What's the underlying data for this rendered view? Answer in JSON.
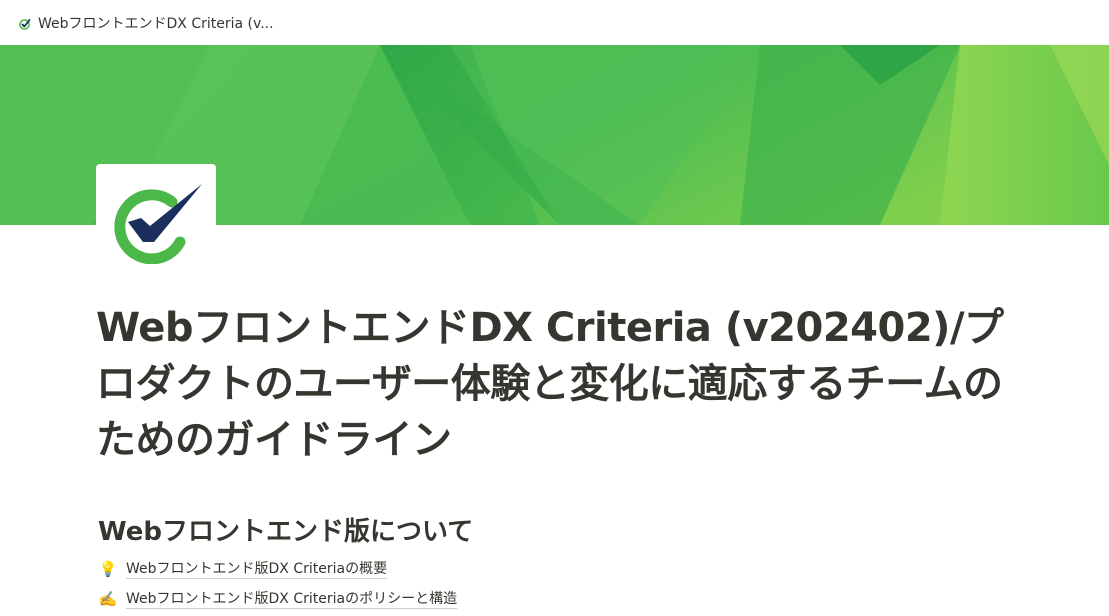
{
  "topbar": {
    "breadcrumb_icon": "check-mark-icon",
    "breadcrumb_title": "WebフロントエンドDX Criteria (v..."
  },
  "cover": {
    "colors": [
      "#5cc04f",
      "#3db34a",
      "#8bd34c",
      "#2ea847"
    ]
  },
  "page": {
    "icon": "green-check-logo-icon",
    "title": "WebフロントエンドDX Criteria (v202402)/プロダクトのユーザー体験と変化に適応するチームのためのガイドライン"
  },
  "section": {
    "heading": "Webフロントエンド版について",
    "links": [
      {
        "emoji": "💡",
        "icon": "lightbulb-icon",
        "label": "Webフロントエンド版DX Criteriaの概要"
      },
      {
        "emoji": "✍️",
        "icon": "writing-hand-icon",
        "label": "Webフロントエンド版DX Criteriaのポリシーと構造"
      }
    ]
  }
}
